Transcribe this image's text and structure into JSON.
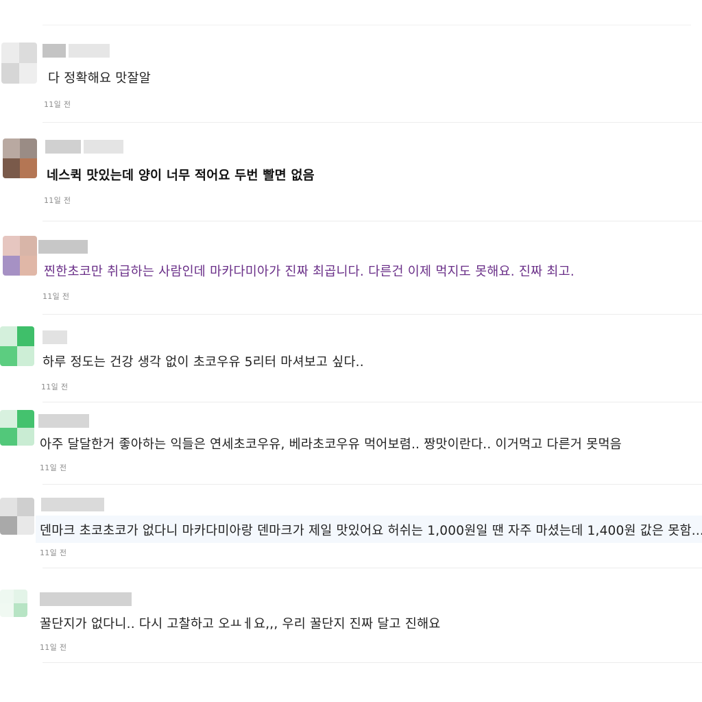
{
  "comments": [
    {
      "text": "다 정확해요 맛잘알",
      "time": "11일 전",
      "color": "#222222"
    },
    {
      "text": "네스퀵 맛있는데 양이 너무 적어요 두번 빨면 없음",
      "time": "11일 전",
      "color": "#111111"
    },
    {
      "text": "찐한초코만 취급하는 사람인데 마카다미아가 진짜 최곱니다. 다른건 이제 먹지도 못해요. 진짜 최고.",
      "time": "11일 전",
      "color": "#6a2f88"
    },
    {
      "text": "하루 정도는 건강 생각 없이 초코우유 5리터 마셔보고 싶다..",
      "time": "11일 전",
      "color": "#222222"
    },
    {
      "text": "아주 달달한거 좋아하는 익들은 연세초코우유, 베라초코우유 먹어보렴.. 짱맛이란다.. 이거먹고 다른거 못먹음",
      "time": "11일 전",
      "color": "#222222"
    },
    {
      "text": "덴마크 초코초코가 없다니 마카다미아랑 덴마크가 제일 맛있어요 허쉬는 1,000원일 땐 자주 마셨는데 1,400원 값은 못함...",
      "time": "11일 전",
      "color": "#222222"
    },
    {
      "text": "꿀단지가 없다니.. 다시 고찰하고 오ㅛㅔ요,,, 우리 꿀단지 진짜 달고 진해요",
      "time": "11일 전",
      "color": "#222222"
    }
  ]
}
